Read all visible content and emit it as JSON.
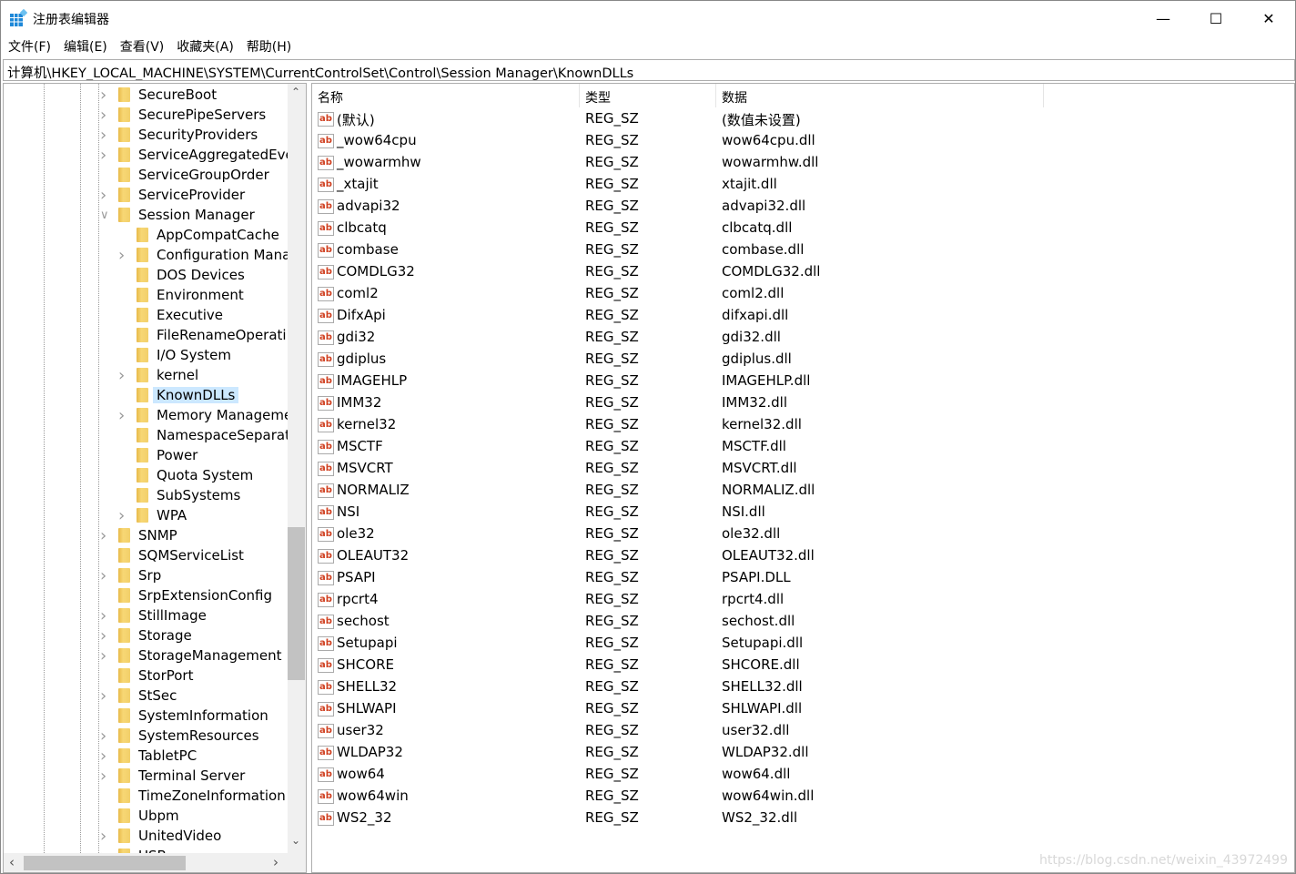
{
  "window": {
    "title": "注册表编辑器",
    "controls": [
      "minimize",
      "maximize",
      "close"
    ]
  },
  "menu": [
    "文件(F)",
    "编辑(E)",
    "查看(V)",
    "收藏夹(A)",
    "帮助(H)"
  ],
  "address": "计算机\\HKEY_LOCAL_MACHINE\\SYSTEM\\CurrentControlSet\\Control\\Session Manager\\KnownDLLs",
  "tree": [
    {
      "label": "SecureBoot",
      "level": 0,
      "exp": ">"
    },
    {
      "label": "SecurePipeServers",
      "level": 0,
      "exp": ">"
    },
    {
      "label": "SecurityProviders",
      "level": 0,
      "exp": ">"
    },
    {
      "label": "ServiceAggregatedEve",
      "level": 0,
      "exp": ">"
    },
    {
      "label": "ServiceGroupOrder",
      "level": 0,
      "exp": ""
    },
    {
      "label": "ServiceProvider",
      "level": 0,
      "exp": ">"
    },
    {
      "label": "Session Manager",
      "level": 0,
      "exp": "v"
    },
    {
      "label": "AppCompatCache",
      "level": 1,
      "exp": ""
    },
    {
      "label": "Configuration Mana",
      "level": 1,
      "exp": ">"
    },
    {
      "label": "DOS Devices",
      "level": 1,
      "exp": ""
    },
    {
      "label": "Environment",
      "level": 1,
      "exp": ""
    },
    {
      "label": "Executive",
      "level": 1,
      "exp": ""
    },
    {
      "label": "FileRenameOperati",
      "level": 1,
      "exp": ""
    },
    {
      "label": "I/O System",
      "level": 1,
      "exp": ""
    },
    {
      "label": "kernel",
      "level": 1,
      "exp": ">"
    },
    {
      "label": "KnownDLLs",
      "level": 1,
      "exp": "",
      "selected": true
    },
    {
      "label": "Memory Manageme",
      "level": 1,
      "exp": ">"
    },
    {
      "label": "NamespaceSeparat",
      "level": 1,
      "exp": ""
    },
    {
      "label": "Power",
      "level": 1,
      "exp": ""
    },
    {
      "label": "Quota System",
      "level": 1,
      "exp": ""
    },
    {
      "label": "SubSystems",
      "level": 1,
      "exp": ""
    },
    {
      "label": "WPA",
      "level": 1,
      "exp": ">"
    },
    {
      "label": "SNMP",
      "level": 0,
      "exp": ">"
    },
    {
      "label": "SQMServiceList",
      "level": 0,
      "exp": ""
    },
    {
      "label": "Srp",
      "level": 0,
      "exp": ">"
    },
    {
      "label": "SrpExtensionConfig",
      "level": 0,
      "exp": ""
    },
    {
      "label": "StillImage",
      "level": 0,
      "exp": ">"
    },
    {
      "label": "Storage",
      "level": 0,
      "exp": ">"
    },
    {
      "label": "StorageManagement",
      "level": 0,
      "exp": ">"
    },
    {
      "label": "StorPort",
      "level": 0,
      "exp": ""
    },
    {
      "label": "StSec",
      "level": 0,
      "exp": ">"
    },
    {
      "label": "SystemInformation",
      "level": 0,
      "exp": ""
    },
    {
      "label": "SystemResources",
      "level": 0,
      "exp": ">"
    },
    {
      "label": "TabletPC",
      "level": 0,
      "exp": ">"
    },
    {
      "label": "Terminal Server",
      "level": 0,
      "exp": ">"
    },
    {
      "label": "TimeZoneInformation",
      "level": 0,
      "exp": ""
    },
    {
      "label": "Ubpm",
      "level": 0,
      "exp": ""
    },
    {
      "label": "UnitedVideo",
      "level": 0,
      "exp": ">"
    },
    {
      "label": "USB",
      "level": 0,
      "exp": ">"
    }
  ],
  "columns": {
    "name": "名称",
    "type": "类型",
    "data": "数据"
  },
  "values": [
    [
      "(默认)",
      "REG_SZ",
      "(数值未设置)"
    ],
    [
      "_wow64cpu",
      "REG_SZ",
      "wow64cpu.dll"
    ],
    [
      "_wowarmhw",
      "REG_SZ",
      "wowarmhw.dll"
    ],
    [
      "_xtajit",
      "REG_SZ",
      "xtajit.dll"
    ],
    [
      "advapi32",
      "REG_SZ",
      "advapi32.dll"
    ],
    [
      "clbcatq",
      "REG_SZ",
      "clbcatq.dll"
    ],
    [
      "combase",
      "REG_SZ",
      "combase.dll"
    ],
    [
      "COMDLG32",
      "REG_SZ",
      "COMDLG32.dll"
    ],
    [
      "coml2",
      "REG_SZ",
      "coml2.dll"
    ],
    [
      "DifxApi",
      "REG_SZ",
      "difxapi.dll"
    ],
    [
      "gdi32",
      "REG_SZ",
      "gdi32.dll"
    ],
    [
      "gdiplus",
      "REG_SZ",
      "gdiplus.dll"
    ],
    [
      "IMAGEHLP",
      "REG_SZ",
      "IMAGEHLP.dll"
    ],
    [
      "IMM32",
      "REG_SZ",
      "IMM32.dll"
    ],
    [
      "kernel32",
      "REG_SZ",
      "kernel32.dll"
    ],
    [
      "MSCTF",
      "REG_SZ",
      "MSCTF.dll"
    ],
    [
      "MSVCRT",
      "REG_SZ",
      "MSVCRT.dll"
    ],
    [
      "NORMALIZ",
      "REG_SZ",
      "NORMALIZ.dll"
    ],
    [
      "NSI",
      "REG_SZ",
      "NSI.dll"
    ],
    [
      "ole32",
      "REG_SZ",
      "ole32.dll"
    ],
    [
      "OLEAUT32",
      "REG_SZ",
      "OLEAUT32.dll"
    ],
    [
      "PSAPI",
      "REG_SZ",
      "PSAPI.DLL"
    ],
    [
      "rpcrt4",
      "REG_SZ",
      "rpcrt4.dll"
    ],
    [
      "sechost",
      "REG_SZ",
      "sechost.dll"
    ],
    [
      "Setupapi",
      "REG_SZ",
      "Setupapi.dll"
    ],
    [
      "SHCORE",
      "REG_SZ",
      "SHCORE.dll"
    ],
    [
      "SHELL32",
      "REG_SZ",
      "SHELL32.dll"
    ],
    [
      "SHLWAPI",
      "REG_SZ",
      "SHLWAPI.dll"
    ],
    [
      "user32",
      "REG_SZ",
      "user32.dll"
    ],
    [
      "WLDAP32",
      "REG_SZ",
      "WLDAP32.dll"
    ],
    [
      "wow64",
      "REG_SZ",
      "wow64.dll"
    ],
    [
      "wow64win",
      "REG_SZ",
      "wow64win.dll"
    ],
    [
      "WS2_32",
      "REG_SZ",
      "WS2_32.dll"
    ]
  ],
  "value_icon": "ab",
  "watermark": "https://blog.csdn.net/weixin_43972499"
}
